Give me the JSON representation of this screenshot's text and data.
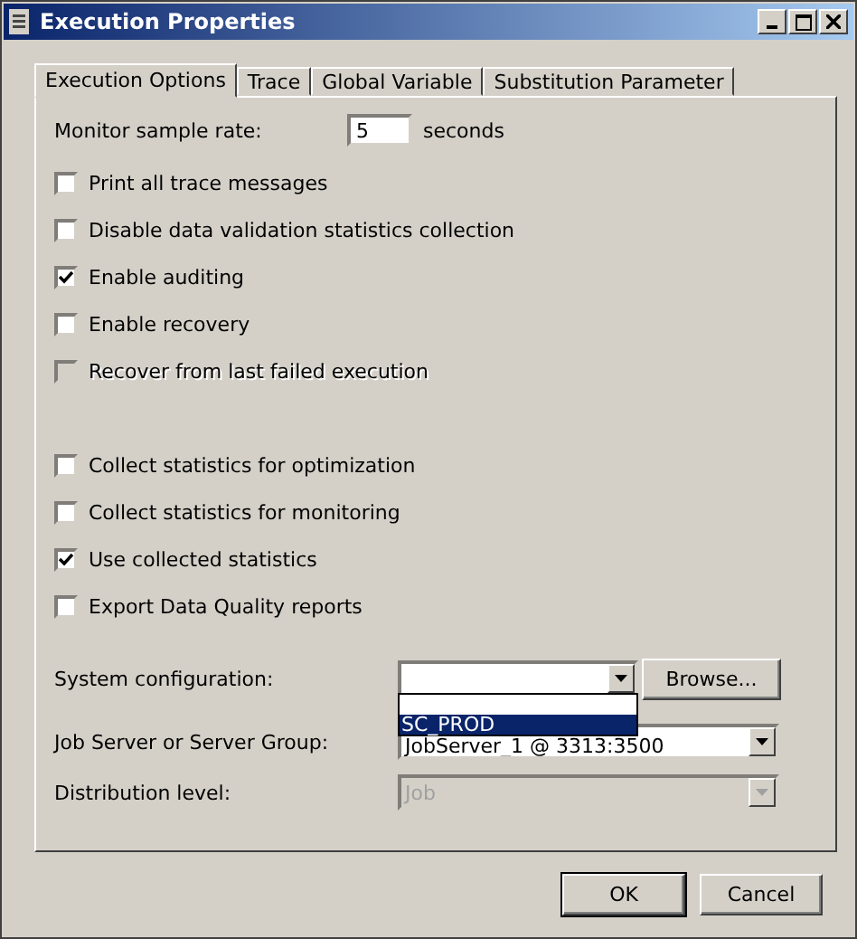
{
  "window": {
    "title": "Execution Properties"
  },
  "tabs": [
    {
      "label": "Execution Options",
      "selected": true
    },
    {
      "label": "Trace",
      "selected": false
    },
    {
      "label": "Global Variable",
      "selected": false
    },
    {
      "label": "Substitution Parameter",
      "selected": false
    }
  ],
  "sample_rate": {
    "label": "Monitor sample rate:",
    "value": "5",
    "unit": "seconds"
  },
  "options": [
    {
      "label": "Print all trace messages",
      "checked": false,
      "disabled": false
    },
    {
      "label": "Disable data validation statistics collection",
      "checked": false,
      "disabled": false
    },
    {
      "label": "Enable auditing",
      "checked": true,
      "disabled": false
    },
    {
      "label": "Enable recovery",
      "checked": false,
      "disabled": false
    },
    {
      "label": "Recover from last failed execution",
      "checked": false,
      "disabled": true
    }
  ],
  "statistics_options": [
    {
      "label": "Collect statistics for optimization",
      "checked": false,
      "disabled": false
    },
    {
      "label": "Collect statistics for monitoring",
      "checked": false,
      "disabled": false
    },
    {
      "label": "Use collected statistics",
      "checked": true,
      "disabled": false
    },
    {
      "label": "Export Data Quality reports",
      "checked": false,
      "disabled": false
    }
  ],
  "system_configuration": {
    "label": "System configuration:",
    "browse": "Browse...",
    "list": [
      {
        "label": "SC_PROD",
        "selected": true
      }
    ]
  },
  "job_server": {
    "label": "Job Server or Server Group:",
    "value": "JobServer_1 @ 3313:3500"
  },
  "distribution": {
    "label": "Distribution level:",
    "value": "Job",
    "disabled": true
  },
  "buttons": [
    "OK",
    "Cancel"
  ]
}
